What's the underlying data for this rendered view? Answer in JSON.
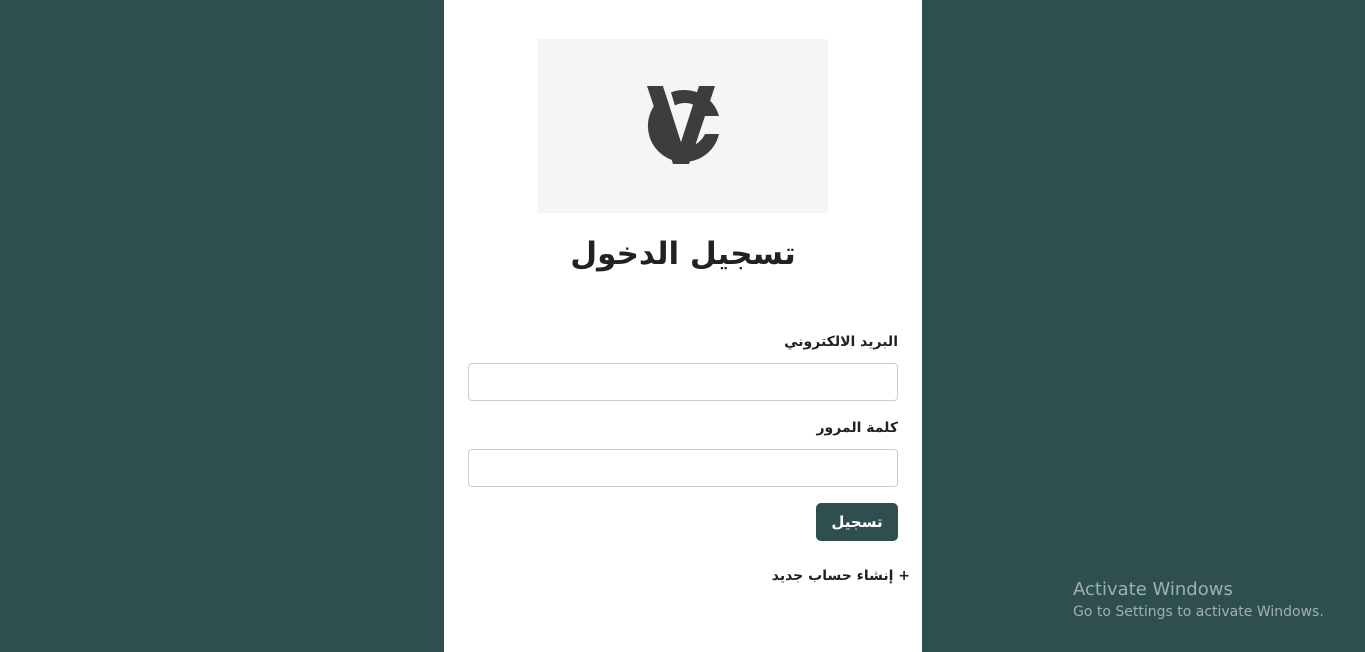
{
  "login": {
    "title": "تسجيل الدخول",
    "email_label": "البريد الالكتروني",
    "email_value": "",
    "password_label": "كلمة المرور",
    "password_value": "",
    "submit_label": "تسجيل",
    "create_account_link": "+ إنشاء حساب جديد"
  },
  "logo": {
    "icon": "vc-monogram-logo"
  },
  "watermark": {
    "title": "Activate Windows",
    "subtitle": "Go to Settings to activate Windows."
  },
  "colors": {
    "background": "#2f4f4f",
    "card": "#ffffff",
    "logo_bg": "#f5f5f5",
    "button": "#2f4f4f",
    "logo_mark": "#3d3d3d"
  }
}
